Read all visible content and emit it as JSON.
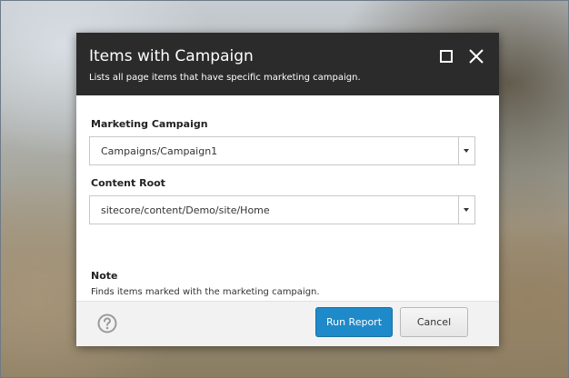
{
  "dialog": {
    "title": "Items with Campaign",
    "subtitle": "Lists all page items that have specific marketing campaign.",
    "header_icons": [
      "maximize-icon",
      "close-icon"
    ]
  },
  "fields": {
    "campaign": {
      "label": "Marketing Campaign",
      "value": "Campaigns/Campaign1"
    },
    "content_root": {
      "label": "Content Root",
      "value": "sitecore/content/Demo/site/Home"
    },
    "note": {
      "label": "Note",
      "text": "Finds items marked with the marketing campaign."
    }
  },
  "footer": {
    "help_icon": "question-circle-icon",
    "run_label": "Run Report",
    "cancel_label": "Cancel"
  },
  "colors": {
    "header_bg": "#2b2b2b",
    "primary_button": "#1f8ac9",
    "footer_bg": "#f2f2f2"
  }
}
